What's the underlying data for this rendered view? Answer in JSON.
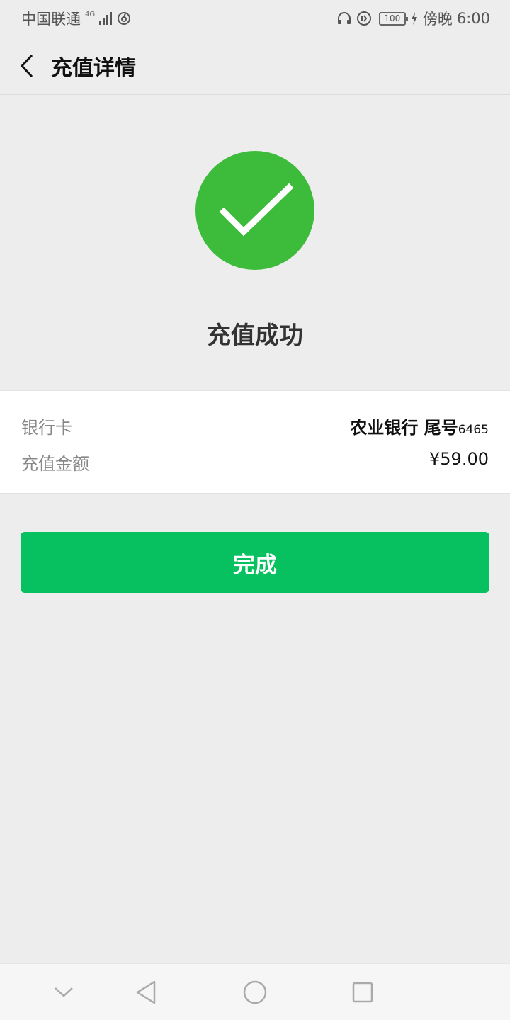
{
  "status_bar": {
    "carrier": "中国联通",
    "network_tag": "4G",
    "battery_level": "100",
    "time_period": "傍晚",
    "time": "6:00"
  },
  "nav": {
    "title": "充值详情"
  },
  "result": {
    "title": "充值成功",
    "icon": "checkmark-circle-icon",
    "accent_color": "#3dbb3b"
  },
  "details": {
    "bank_label": "银行卡",
    "bank_name": "农业银行 尾号",
    "card_tail": "6465",
    "amount_label": "充值金额",
    "amount_value": "¥59.00"
  },
  "actions": {
    "done_label": "完成",
    "button_color": "#07c160"
  },
  "system_nav": {
    "icons": [
      "collapse-chevron-icon",
      "back-triangle-icon",
      "home-circle-icon",
      "recents-square-icon"
    ]
  }
}
